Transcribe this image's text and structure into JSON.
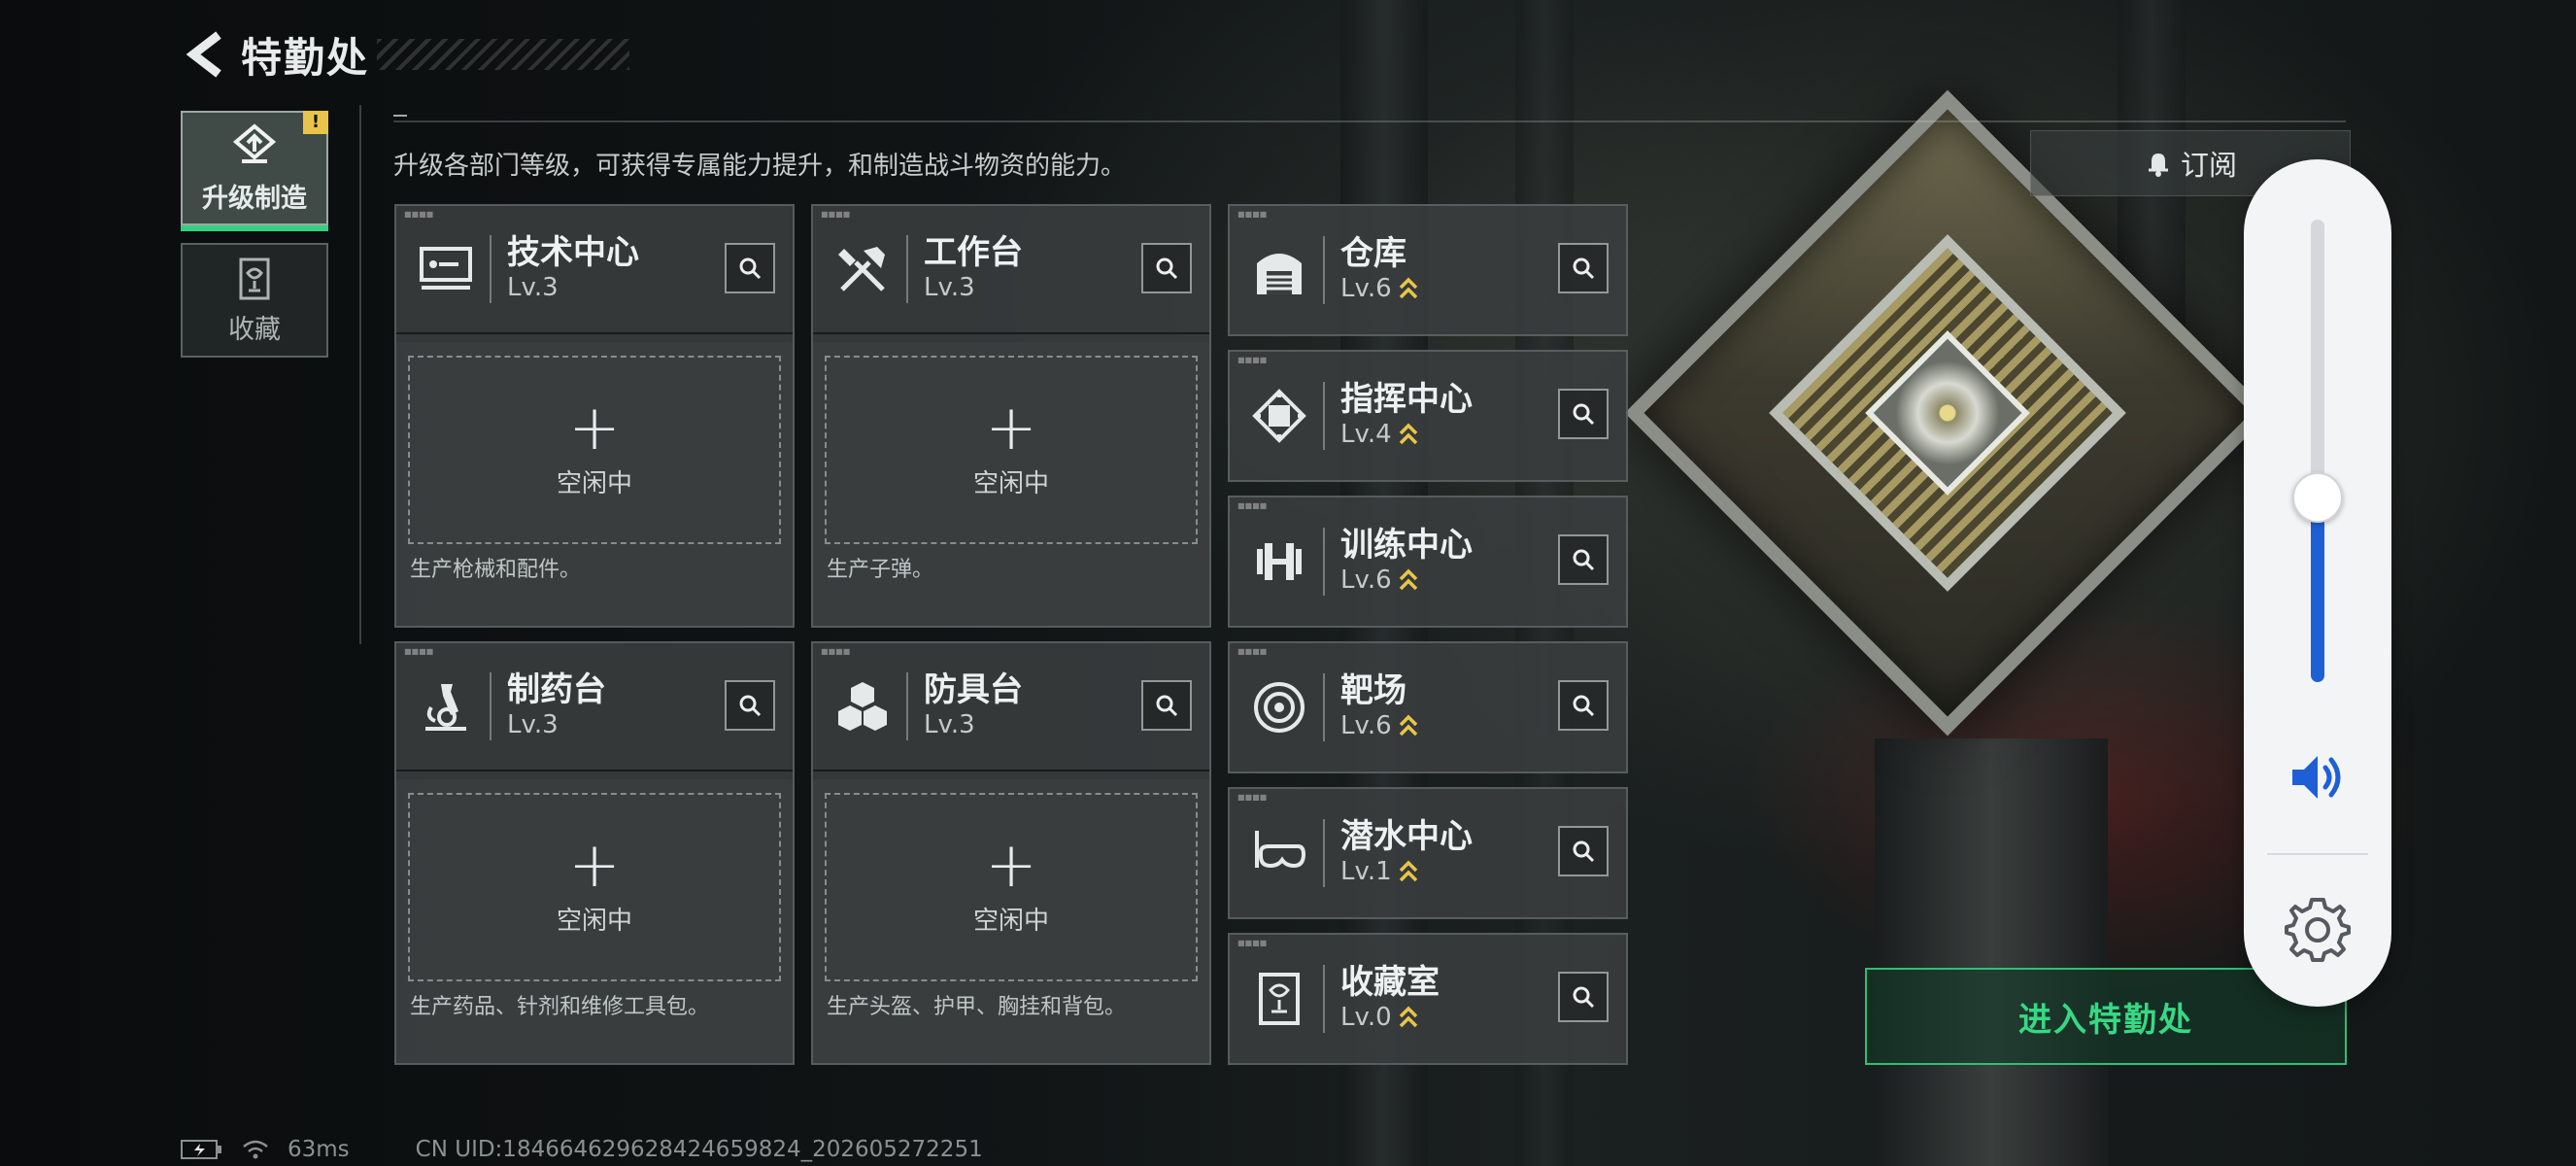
{
  "header": {
    "title": "特勤处"
  },
  "side_tabs": [
    {
      "label": "升级制造",
      "icon": "upgrade-icon",
      "active": true,
      "badge": "!"
    },
    {
      "label": "收藏",
      "icon": "trophy-icon",
      "active": false
    }
  ],
  "subtitle": "升级各部门等级，可获得专属能力提升，和制造战斗物资的能力。",
  "production_cards": [
    {
      "name": "技术中心",
      "level": "Lv.3",
      "status": "空闲中",
      "description": "生产枪械和配件。",
      "icon": "computer-icon"
    },
    {
      "name": "工作台",
      "level": "Lv.3",
      "status": "空闲中",
      "description": "生产子弹。",
      "icon": "tools-icon"
    },
    {
      "name": "制药台",
      "level": "Lv.3",
      "status": "空闲中",
      "description": "生产药品、针剂和维修工具包。",
      "icon": "microscope-icon"
    },
    {
      "name": "防具台",
      "level": "Lv.3",
      "status": "空闲中",
      "description": "生产头盔、护甲、胸挂和背包。",
      "icon": "armor-cubes-icon"
    }
  ],
  "facilities": [
    {
      "name": "仓库",
      "level": "Lv.6",
      "icon": "warehouse-icon",
      "upgradable": true
    },
    {
      "name": "指挥中心",
      "level": "Lv.4",
      "icon": "chip-icon",
      "upgradable": true
    },
    {
      "name": "训练中心",
      "level": "Lv.6",
      "icon": "dumbbell-icon",
      "upgradable": true
    },
    {
      "name": "靶场",
      "level": "Lv.6",
      "icon": "target-icon",
      "upgradable": true
    },
    {
      "name": "潜水中心",
      "level": "Lv.1",
      "icon": "diving-mask-icon",
      "upgradable": true
    },
    {
      "name": "收藏室",
      "level": "Lv.0",
      "icon": "trophy-icon",
      "upgradable": true
    }
  ],
  "subscribe_label": "订阅",
  "enter_label": "进入特勤处",
  "volume": {
    "level_percent": 40,
    "icon": "speaker-icon",
    "settings_icon": "gear-icon"
  },
  "status_bar": {
    "ping": "63ms",
    "uid": "CN UID:18466462962842465982­4_202605272251"
  },
  "colors": {
    "accent_green": "#35d07f",
    "upgrade_gold": "#e8c54a",
    "volume_blue": "#1f5fd6"
  }
}
